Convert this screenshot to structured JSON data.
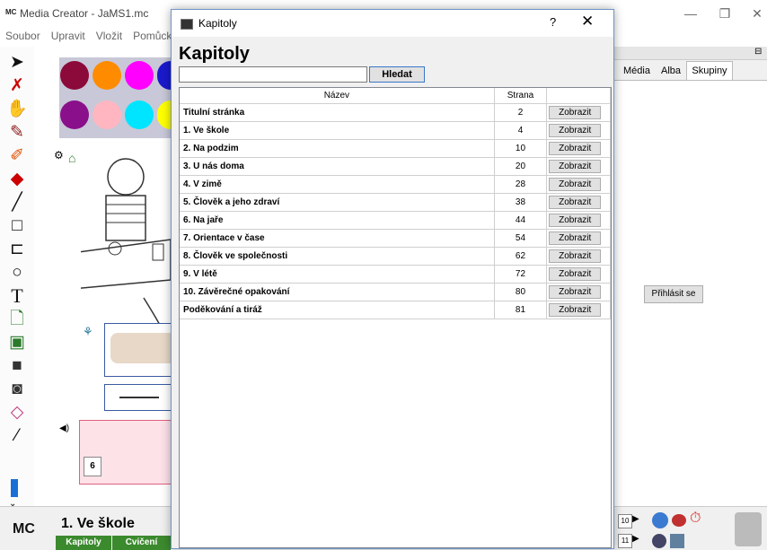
{
  "app": {
    "title": "Media Creator - JaMS1.mc",
    "icon_text": "MC",
    "menu": [
      "Soubor",
      "Upravit",
      "Vložit",
      "Pomůcky"
    ],
    "chapter_title": "1. Ve škole",
    "logo": "MC",
    "bottom_tabs": [
      "Kapitoly",
      "Cvičení"
    ]
  },
  "right_panel": {
    "tabs": [
      "Média",
      "Alba",
      "Skupiny"
    ],
    "active_tab": "Skupiny",
    "login_label": "Přihlásit se",
    "page_numbers": [
      "10",
      "11"
    ]
  },
  "dialog": {
    "window_title": "Kapitoly",
    "help_label": "?",
    "close_label": "✕",
    "heading": "Kapitoly",
    "search_value": "",
    "search_button": "Hledat",
    "columns": [
      "Název",
      "Strana",
      ""
    ],
    "show_label": "Zobrazit",
    "rows": [
      {
        "name": "Titulní stránka",
        "page": "2"
      },
      {
        "name": "1. Ve škole",
        "page": "4"
      },
      {
        "name": "2. Na podzim",
        "page": "10"
      },
      {
        "name": "3. U nás doma",
        "page": "20"
      },
      {
        "name": "4. V zimě",
        "page": "28"
      },
      {
        "name": "5. Člověk a jeho zdraví",
        "page": "38"
      },
      {
        "name": "6. Na jaře",
        "page": "44"
      },
      {
        "name": "7. Orientace v čase",
        "page": "54"
      },
      {
        "name": "8. Člověk ve společnosti",
        "page": "62"
      },
      {
        "name": "9. V létě",
        "page": "72"
      },
      {
        "name": "10. Závěrečné opakování",
        "page": "80"
      },
      {
        "name": "Poděkování a tiráž",
        "page": "81"
      }
    ]
  },
  "colors": {
    "palette": [
      "#8b0a3a",
      "#ff8c00",
      "#ff00ff",
      "#8a0f8a",
      "#ffb6c1",
      "#00e5ff",
      "#1a1acc"
    ],
    "accent_green": "#3c8a2e",
    "tool_red": "#cc0000"
  },
  "tool_icons": [
    "arrow-icon",
    "eraser-cross-icon",
    "hand-icon",
    "pen-icon",
    "highlighter-icon",
    "eraser-icon",
    "line-icon",
    "rectangle-icon",
    "polyline-icon",
    "ellipse-icon",
    "text-icon",
    "note-icon",
    "image-icon",
    "ic-icon",
    "camera-icon",
    "hide-icon",
    "eyedropper-icon"
  ]
}
